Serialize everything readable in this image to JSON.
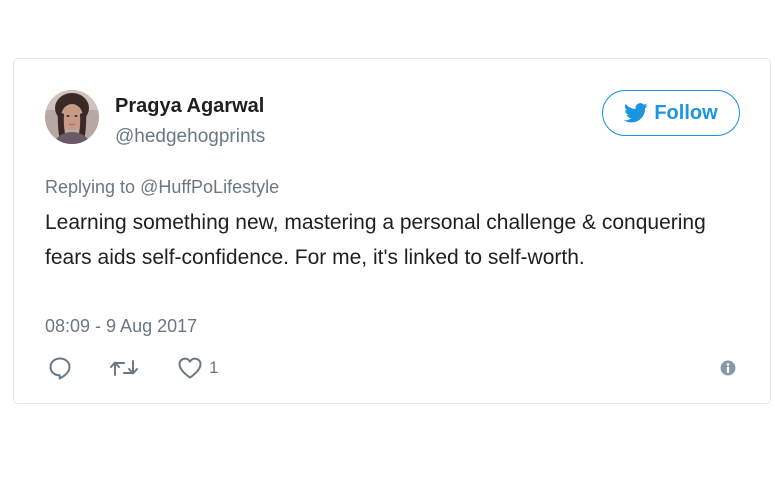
{
  "tweet": {
    "author": {
      "display_name": "Pragya Agarwal",
      "handle": "@hedgehogprints",
      "avatar": "profile-photo"
    },
    "follow_button": {
      "label": "Follow",
      "icon": "twitter-bird-icon"
    },
    "reply_context": {
      "prefix": "Replying to",
      "handle": "@HuffPoLifestyle"
    },
    "text": "Learning something new, mastering a personal challenge & conquering fears aids self-confidence. For me, it's linked to self-worth.",
    "timestamp": "08:09 - 9 Aug 2017",
    "actions": {
      "reply_icon": "reply-icon",
      "retweet_icon": "retweet-icon",
      "like_icon": "heart-icon",
      "like_count": "1",
      "info_icon": "info-icon"
    },
    "colors": {
      "accent": "#1b95e0",
      "text": "#1c2022",
      "muted": "#697882",
      "border": "#e1e8ed"
    }
  }
}
